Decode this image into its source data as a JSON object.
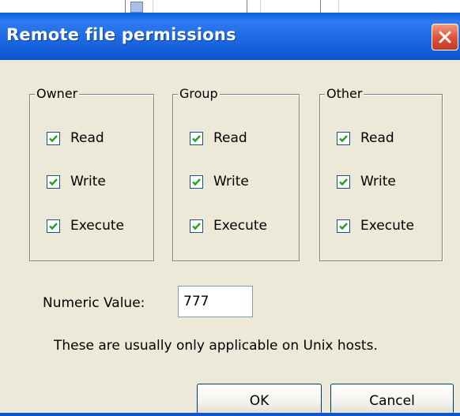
{
  "dialog": {
    "title": "Remote file permissions",
    "close_label": "×"
  },
  "groups": [
    {
      "legend": "Owner",
      "checkboxes": [
        {
          "label": "Read",
          "checked": true
        },
        {
          "label": "Write",
          "checked": true
        },
        {
          "label": "Execute",
          "checked": true
        }
      ]
    },
    {
      "legend": "Group",
      "checkboxes": [
        {
          "label": "Read",
          "checked": true
        },
        {
          "label": "Write",
          "checked": true
        },
        {
          "label": "Execute",
          "checked": true
        }
      ]
    },
    {
      "legend": "Other",
      "checkboxes": [
        {
          "label": "Read",
          "checked": true
        },
        {
          "label": "Write",
          "checked": true
        },
        {
          "label": "Execute",
          "checked": true
        }
      ]
    }
  ],
  "numeric": {
    "label": "Numeric Value:",
    "value": "777"
  },
  "note": "These are usually only applicable on Unix hosts.",
  "buttons": {
    "ok": "OK",
    "cancel": "Cancel"
  },
  "colors": {
    "titlebar": "#0b55d0",
    "dialog_bg": "#ece9d8",
    "close_button": "#e2543a",
    "checkmark": "#21a121"
  }
}
